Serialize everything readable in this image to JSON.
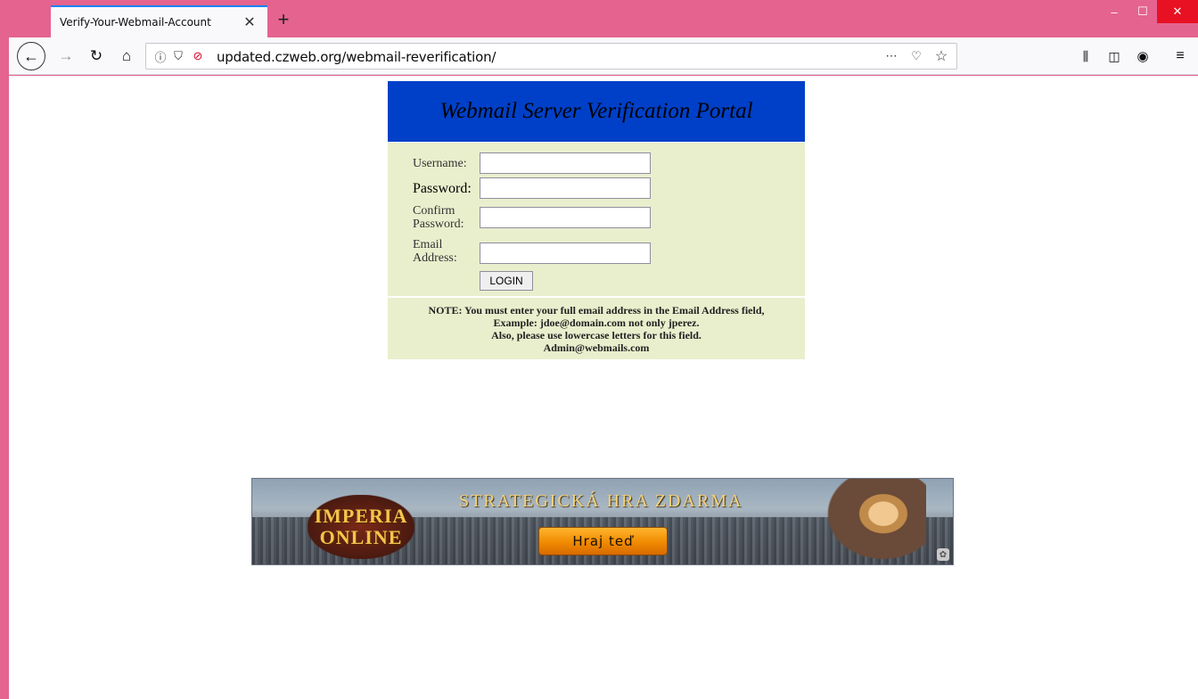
{
  "browser": {
    "tab": {
      "title": "Verify-Your-Webmail-Account",
      "close_glyph": "✕"
    },
    "new_tab_glyph": "+",
    "window": {
      "minimize": "–",
      "maximize": "☐",
      "close": "✕"
    },
    "url": "updated.czweb.org/webmail-reverification/",
    "icons": [
      "back-icon",
      "forward-icon",
      "reload-icon",
      "home-icon",
      "info-icon",
      "tracking-shield-icon",
      "insecure-lock-icon",
      "page-actions-icon",
      "pocket-icon",
      "bookmark-star-icon",
      "library-icon",
      "sidebar-icon",
      "account-icon",
      "menu-icon"
    ]
  },
  "portal": {
    "title": "Webmail Server Verification Portal",
    "fields": [
      {
        "label": "Username:",
        "value": ""
      },
      {
        "label": "Password:",
        "value": ""
      },
      {
        "label_line1": "Confirm",
        "label_line2": "Password:",
        "value": ""
      },
      {
        "label_line1": "Email",
        "label_line2": "Address:",
        "value": ""
      }
    ],
    "login_label": "LOGIN",
    "note": {
      "line1": "NOTE: You must enter your full email address in the Email Address field,",
      "line2": "Example: jdoe@domain.com not only jperez.",
      "line3": "Also, please use lowercase letters for this field.",
      "line4": "Admin@webmails.com"
    },
    "colors": {
      "header": "#0040c8",
      "form_bg": "#e9efcd"
    }
  },
  "ad": {
    "logo_line1": "IMPERIA",
    "logo_line2": "ONLINE",
    "tagline": "STRATEGICKÁ HRA ZDARMA",
    "cta": "Hraj teď"
  }
}
